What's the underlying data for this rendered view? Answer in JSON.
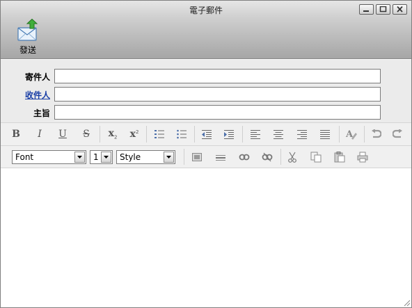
{
  "window": {
    "title": "電子郵件"
  },
  "toolbar_main": {
    "send_label": "發送"
  },
  "fields": {
    "from": {
      "label": "寄件人",
      "value": ""
    },
    "to": {
      "label": "收件人",
      "value": ""
    },
    "subject": {
      "label": "主旨",
      "value": ""
    }
  },
  "format_toolbar": {
    "bold": "B",
    "italic": "I",
    "underline": "U",
    "strike": "S",
    "subscript": "x",
    "subscript_mark": "2",
    "superscript": "x",
    "superscript_mark": "2"
  },
  "font_toolbar": {
    "font_select": "Font",
    "size_select": "1",
    "style_select": "Style"
  },
  "editor": {
    "content": ""
  }
}
